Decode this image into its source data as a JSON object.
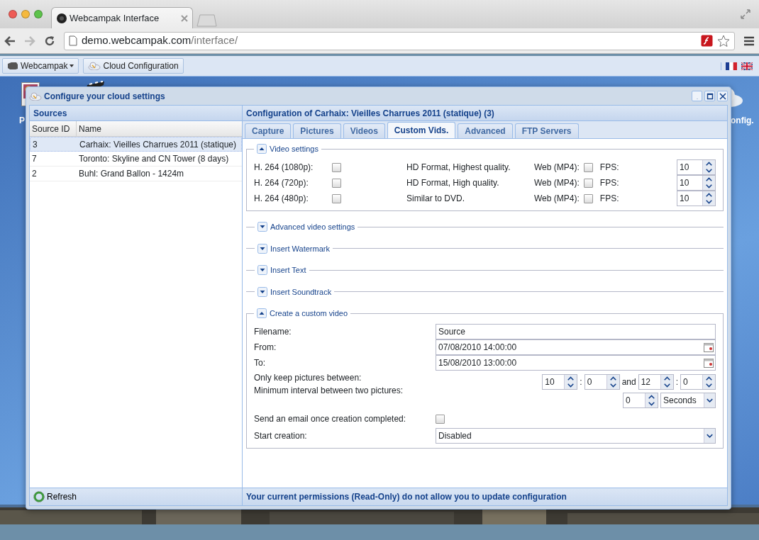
{
  "browser": {
    "tab_title": "Webcampak Interface",
    "url_host": "demo.webcampak.com",
    "url_path": "/interface/"
  },
  "app_toolbar": {
    "menu": "Webcampak",
    "button": "Cloud Configuration"
  },
  "desktop_icons": [
    {
      "label": "P"
    },
    {
      "label": "onfig."
    }
  ],
  "dialog": {
    "title": "Configure your cloud settings",
    "sources": {
      "title": "Sources",
      "columns": [
        "Source ID",
        "Name"
      ],
      "rows": [
        {
          "id": "3",
          "name": "Carhaix: Vieilles Charrues 2011 (statique)",
          "selected": true
        },
        {
          "id": "7",
          "name": "Toronto: Skyline and CN Tower (8 days)",
          "selected": false
        },
        {
          "id": "2",
          "name": "Buhl: Grand Ballon - 1424m",
          "selected": false
        }
      ],
      "refresh": "Refresh"
    },
    "config": {
      "title": "Configuration of Carhaix: Vieilles Charrues 2011 (statique) (3)",
      "tabs": [
        {
          "label": "Capture",
          "selected": false
        },
        {
          "label": "Pictures",
          "selected": false
        },
        {
          "label": "Videos",
          "selected": false
        },
        {
          "label": "Custom Vids.",
          "selected": true
        },
        {
          "label": "Advanced",
          "selected": false
        },
        {
          "label": "FTP Servers",
          "selected": false
        }
      ],
      "sections": [
        {
          "title": "Video settings",
          "expanded": true,
          "kind": "formats",
          "rows": [
            {
              "format": "H. 264 (1080p):",
              "checked": false,
              "description": "HD Format, Highest quality.",
              "web_label": "Web (MP4):",
              "web_checked": false,
              "fps_label": "FPS:",
              "fps": "10"
            },
            {
              "format": "H. 264 (720p):",
              "checked": false,
              "description": "HD Format, High quality.",
              "web_label": "Web (MP4):",
              "web_checked": false,
              "fps_label": "FPS:",
              "fps": "10"
            },
            {
              "format": "H. 264 (480p):",
              "checked": false,
              "description": "Similar to DVD.",
              "web_label": "Web (MP4):",
              "web_checked": false,
              "fps_label": "FPS:",
              "fps": "10"
            }
          ]
        },
        {
          "title": "Advanced video settings",
          "expanded": false
        },
        {
          "title": "Insert Watermark",
          "expanded": false
        },
        {
          "title": "Insert Text",
          "expanded": false
        },
        {
          "title": "Insert Soundtrack",
          "expanded": false
        },
        {
          "title": "Create a custom video",
          "expanded": true,
          "kind": "fields",
          "fields": [
            {
              "kind": "text",
              "label": "Filename:",
              "value": "Source"
            },
            {
              "kind": "date",
              "label": "From:",
              "value": "07/08/2010 14:00:00"
            },
            {
              "kind": "date",
              "label": "To:",
              "value": "15/08/2010 13:00:00"
            },
            {
              "kind": "time_range",
              "label": "Only keep pictures between:",
              "from_hour": "10",
              "from_minute": "0",
              "joiner": "and",
              "to_hour": "12",
              "to_minute": "0",
              "separator": ":"
            },
            {
              "kind": "interval",
              "label": "Minimum interval between two pictures:",
              "value": "0",
              "unit": "Seconds"
            },
            {
              "kind": "checkbox",
              "label": "Send an email once creation completed:",
              "checked": false
            },
            {
              "kind": "select",
              "label": "Start creation:",
              "value": "Disabled"
            }
          ]
        }
      ],
      "status": "Your current permissions (Read-Only) do not allow you to update configuration"
    }
  }
}
